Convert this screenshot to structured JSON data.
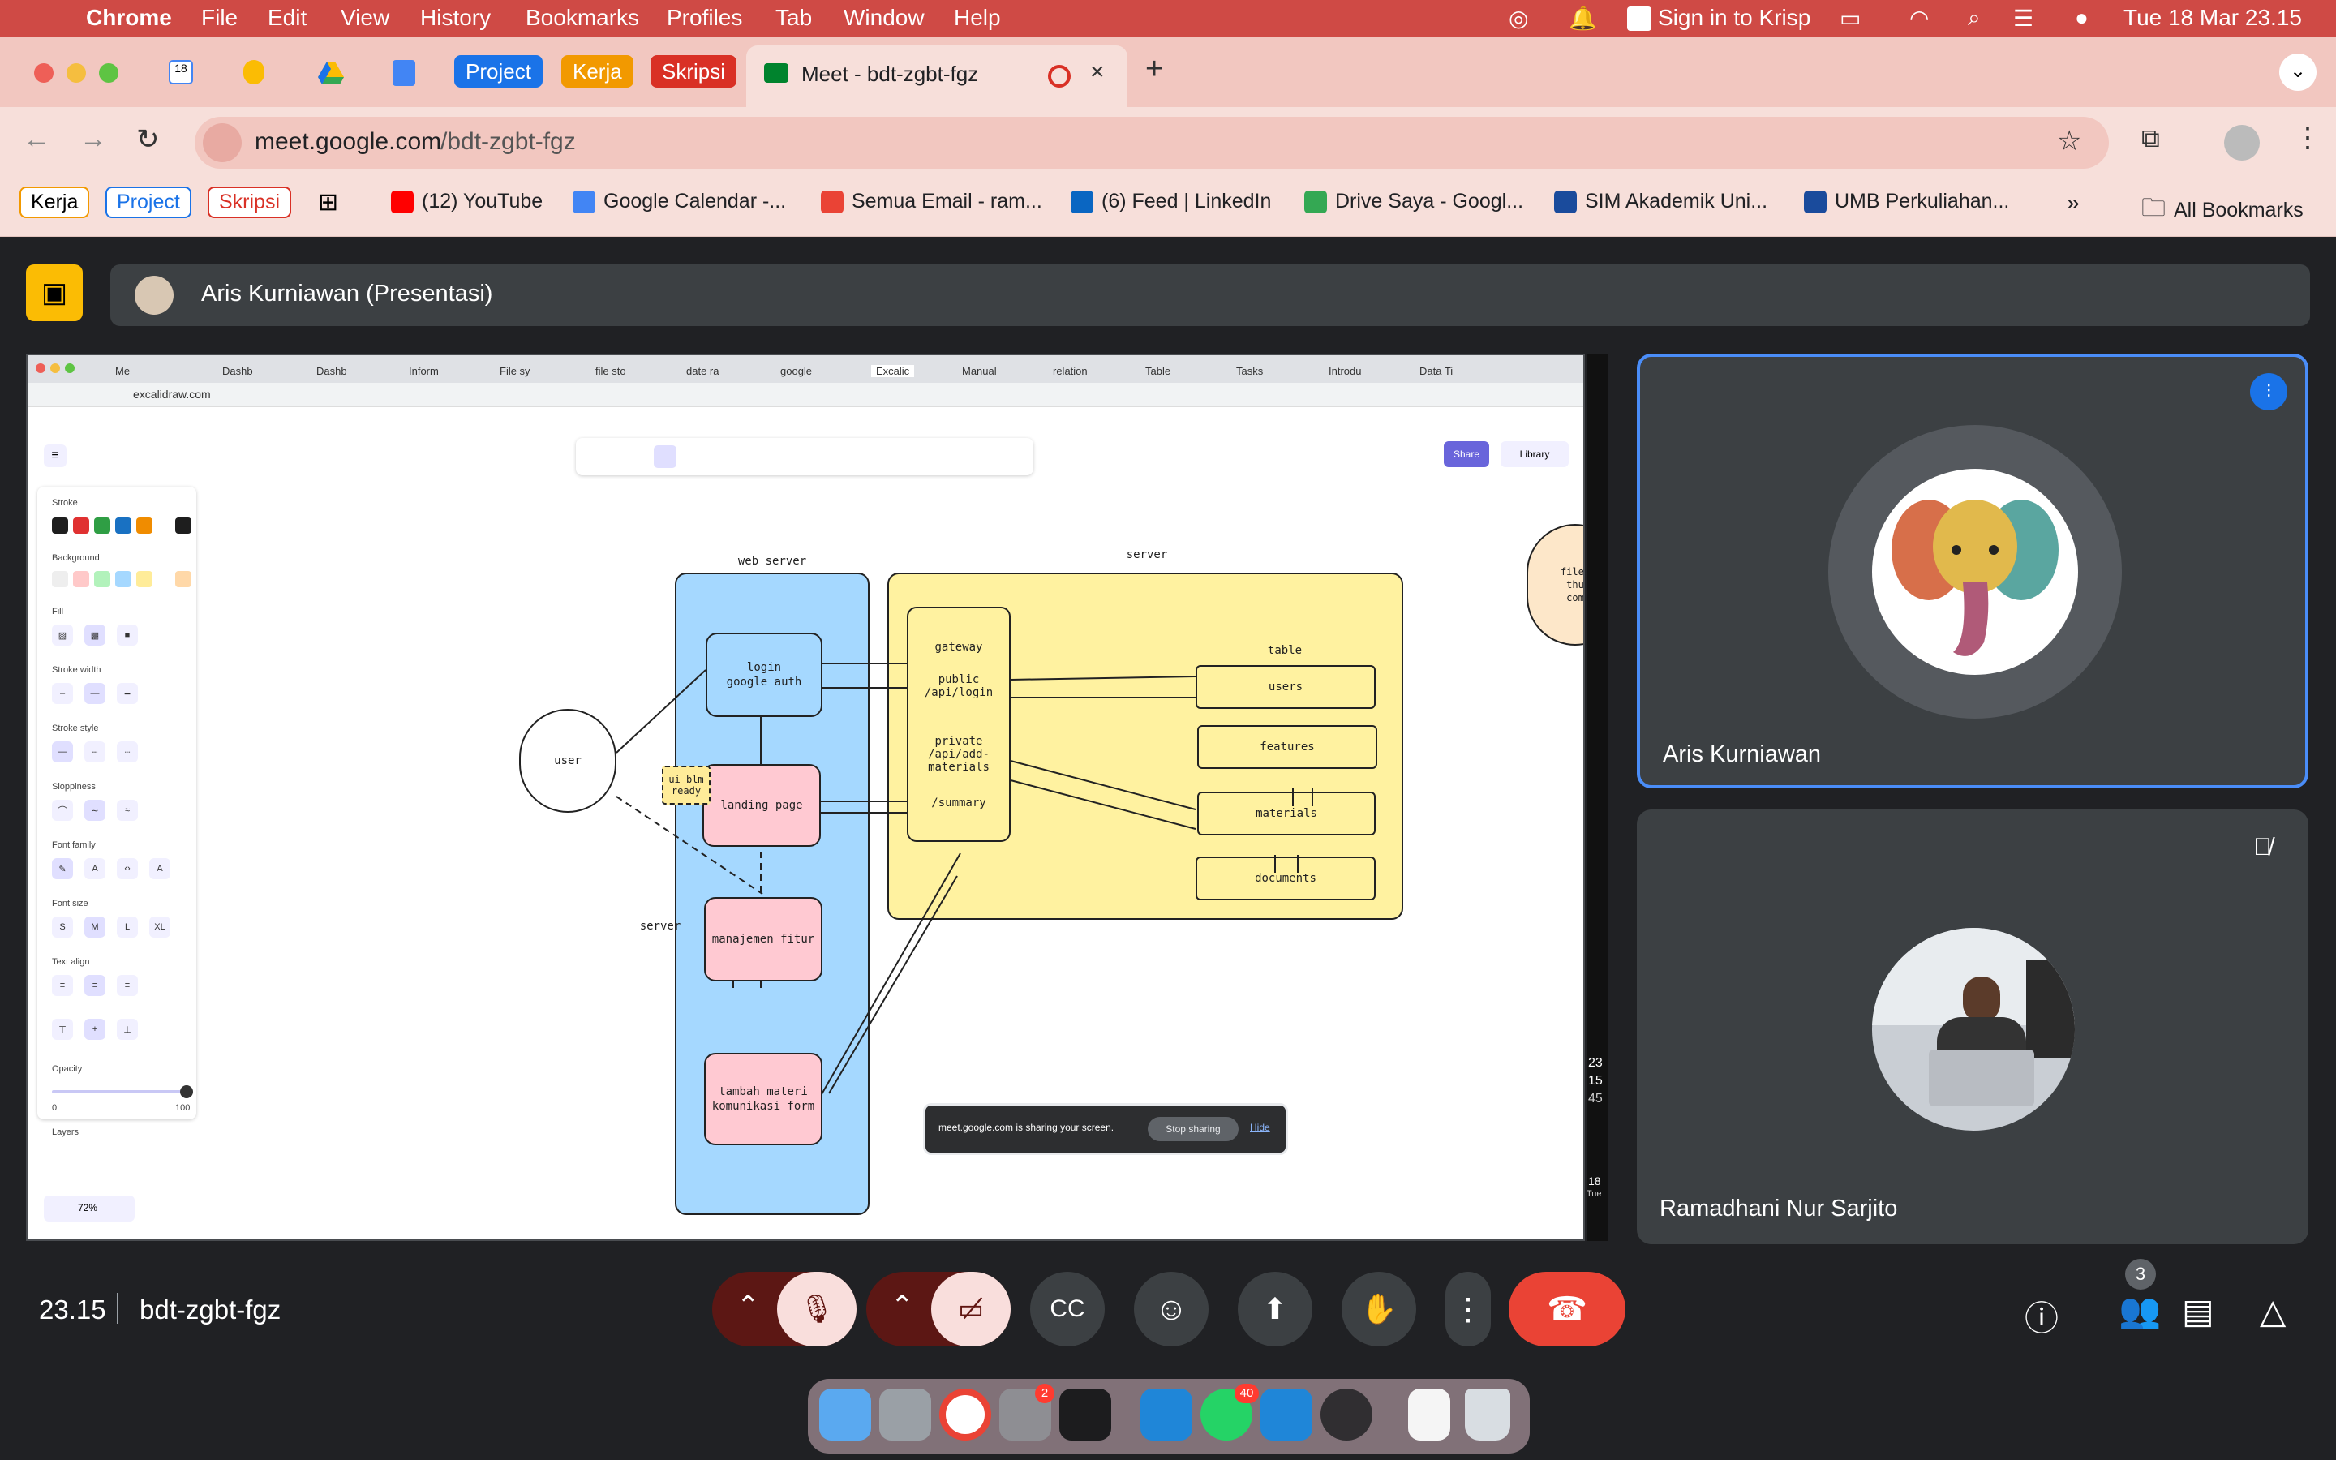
{
  "menubar": {
    "app": "Chrome",
    "items": [
      "File",
      "Edit",
      "View",
      "History",
      "Bookmarks",
      "Profiles",
      "Tab",
      "Window",
      "Help"
    ],
    "krisp": "Sign in to Krisp",
    "clock": "Tue 18 Mar  23.15"
  },
  "tabs": {
    "groups": [
      "Project",
      "Kerja",
      "Skripsi"
    ],
    "active_title": "Meet - bdt-zgbt-fgz"
  },
  "address": {
    "url_domain": "meet.google.com",
    "url_path": "/bdt-zgbt-fgz"
  },
  "bookmarks": {
    "groups": [
      "Kerja",
      "Project",
      "Skripsi"
    ],
    "items": [
      "(12) YouTube",
      "Google Calendar -...",
      "Semua Email - ram...",
      "(6) Feed | LinkedIn",
      "Drive Saya - Googl...",
      "SIM Akademik Uni...",
      "UMB Perkuliahan..."
    ],
    "all": "All Bookmarks"
  },
  "meet": {
    "presenter_banner": "Aris Kurniawan (Presentasi)",
    "participants": [
      {
        "name": "Aris Kurniawan",
        "speaking": true
      },
      {
        "name": "Ramadhani Nur Sarjito",
        "muted": true
      }
    ],
    "time": "23.15",
    "meeting_code": "bdt-zgbt-fgz",
    "people_count": "3"
  },
  "shared": {
    "tabs": [
      "Me",
      "Dashb",
      "Dashb",
      "Inform",
      "File sy",
      "file sto",
      "date ra",
      "google",
      "Excalic",
      "Manual",
      "relation",
      "Table",
      "Tasks",
      "Introdu",
      "Data Ti"
    ],
    "url": "excalidraw.com",
    "share_btn": "Share",
    "library_btn": "Library",
    "panel": {
      "stroke": "Stroke",
      "background": "Background",
      "fill": "Fill",
      "stroke_width": "Stroke width",
      "stroke_style": "Stroke style",
      "sloppiness": "Sloppiness",
      "font_family": "Font family",
      "font_size": "Font size",
      "sizes": [
        "S",
        "M",
        "L",
        "XL"
      ],
      "text_align": "Text align",
      "opacity": "Opacity",
      "opacity_min": "0",
      "opacity_max": "100",
      "layers": "Layers"
    },
    "zoom": "72%",
    "diagram": {
      "web_server": "web server",
      "server_top": "server",
      "server_side": "server",
      "user": "user",
      "login": "login\ngoogle auth",
      "landing": "landing page",
      "ui_note": "ui blm\nready",
      "manajemen": "manajemen fitur",
      "tambah": "tambah materi\nkomunikasi form",
      "gateway": "gateway",
      "public": "public\n/api/login",
      "private": "private\n/api/add-\nmaterials",
      "summary": "/summary",
      "table": "table",
      "users": "users",
      "features": "features",
      "materials": "materials",
      "documents": "documents",
      "file_partial": "file_\nthu\ncom"
    },
    "share_notice": "meet.google.com is sharing your screen.",
    "stop_sharing": "Stop sharing",
    "hide": "Hide",
    "side_clock": [
      "23",
      "15",
      "45",
      "18",
      "Tue"
    ]
  },
  "colors": {
    "menubar": "#cf4a45",
    "web_server_fill": "#a5d8ff",
    "server_fill": "#fff2a0",
    "page_box": "#ffc9d2",
    "end_call": "#ea4335",
    "speaking": "#1a73e8"
  },
  "dock_badges": {
    "settings": "2",
    "whatsapp": "40"
  }
}
